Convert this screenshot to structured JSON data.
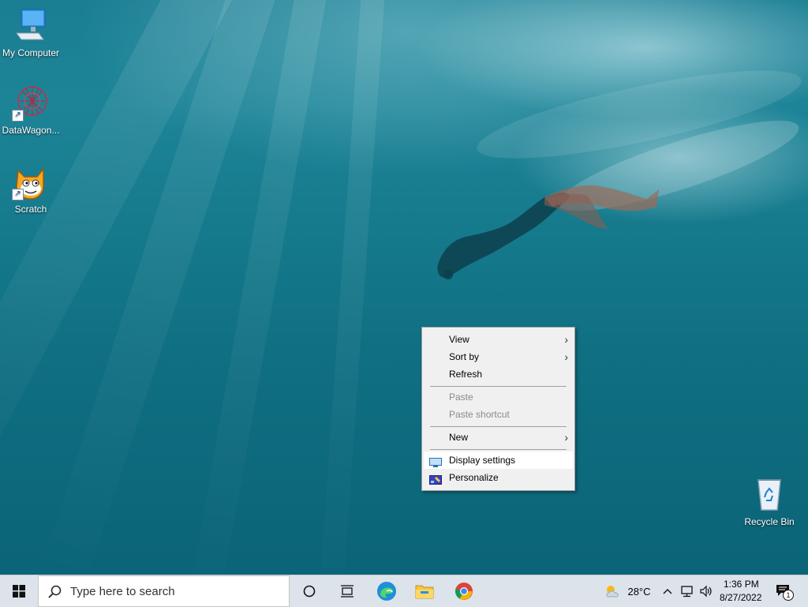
{
  "desktop": {
    "icons": [
      {
        "label": "My Computer"
      },
      {
        "label": "DataWagon..."
      },
      {
        "label": "Scratch"
      },
      {
        "label": "Recycle Bin"
      }
    ]
  },
  "context_menu": {
    "items": [
      {
        "label": "View",
        "has_submenu": true
      },
      {
        "label": "Sort by",
        "has_submenu": true
      },
      {
        "label": "Refresh"
      },
      {
        "label": "Paste",
        "disabled": true
      },
      {
        "label": "Paste shortcut",
        "disabled": true
      },
      {
        "label": "New",
        "has_submenu": true
      },
      {
        "label": "Display settings",
        "highlighted": true
      },
      {
        "label": "Personalize"
      }
    ],
    "submenu_arrow": "›"
  },
  "taskbar": {
    "search_placeholder": "Type here to search",
    "weather": {
      "temp": "28°C",
      "icon": "partly-sunny-icon"
    },
    "clock": {
      "time": "1:36 PM",
      "date": "8/27/2022"
    },
    "notification_count": "1"
  },
  "colors": {
    "taskbar_bg": "#dde3ea",
    "menu_bg": "#f0f0f0",
    "menu_highlight": "#ffffff",
    "windows_blue": "#0078d7"
  }
}
